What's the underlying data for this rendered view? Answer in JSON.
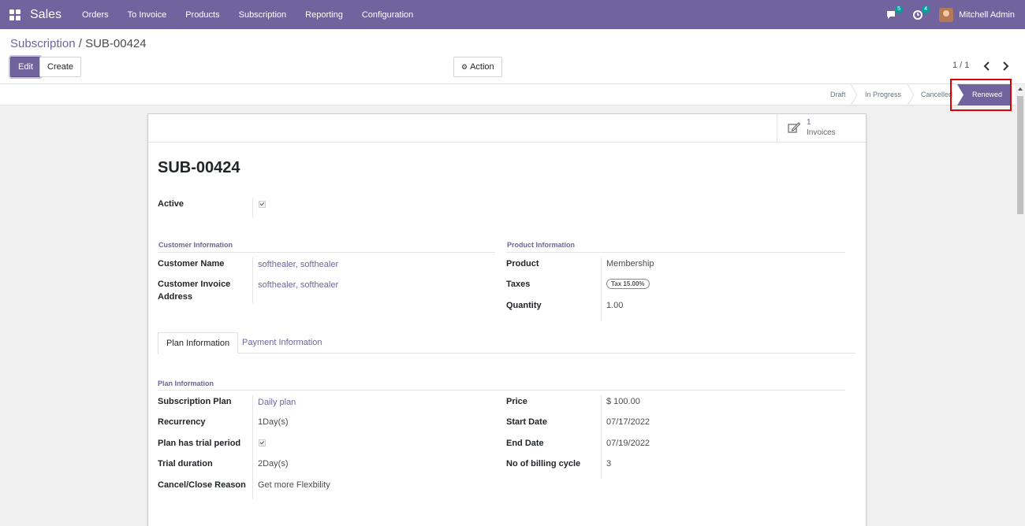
{
  "navbar": {
    "brand": "Sales",
    "menu": [
      "Orders",
      "To Invoice",
      "Products",
      "Subscription",
      "Reporting",
      "Configuration"
    ],
    "messages_count": "5",
    "activities_count": "4",
    "user_name": "Mitchell Admin"
  },
  "breadcrumb": {
    "parent": "Subscription",
    "separator": "/",
    "current": "SUB-00424"
  },
  "toolbar": {
    "edit_label": "Edit",
    "create_label": "Create",
    "action_label": "Action",
    "pager": "1 / 1"
  },
  "statusbar": {
    "stages": [
      "Draft",
      "In Progress",
      "Cancelled",
      "Renewed"
    ],
    "active_stage": "Renewed"
  },
  "smart_button": {
    "count": "1",
    "label": "Invoices"
  },
  "form": {
    "title": "SUB-00424",
    "active_label": "Active",
    "customer_section": "Customer Information",
    "customer_name_label": "Customer Name",
    "customer_name_value": "softhealer, softhealer",
    "customer_invoice_label_1": "Customer Invoice",
    "customer_invoice_label_2": "Address",
    "customer_invoice_value": "softhealer, softhealer",
    "product_section": "Product Information",
    "product_label": "Product",
    "product_value": "Membership",
    "taxes_label": "Taxes",
    "taxes_value": "Tax 15.00%",
    "quantity_label": "Quantity",
    "quantity_value": "1.00"
  },
  "tabs": [
    "Plan Information",
    "Payment Information"
  ],
  "plan": {
    "section": "Plan Information",
    "subscription_plan_label": "Subscription Plan",
    "subscription_plan_value": "Daily plan",
    "recurrency_label": "Recurrency",
    "recurrency_value": "1Day(s)",
    "trial_label": "Plan has trial period",
    "trial_duration_label": "Trial duration",
    "trial_duration_value": "2Day(s)",
    "cancel_reason_label": "Cancel/Close Reason",
    "cancel_reason_value": "Get more Flexbility",
    "price_label": "Price",
    "price_value": "$ 100.00",
    "start_date_label": "Start Date",
    "start_date_value": "07/17/2022",
    "end_date_label": "End Date",
    "end_date_value": "07/19/2022",
    "billing_cycle_label": "No of billing cycle",
    "billing_cycle_value": "3"
  },
  "colors": {
    "brand": "#71639e",
    "highlight": "#e00000"
  }
}
